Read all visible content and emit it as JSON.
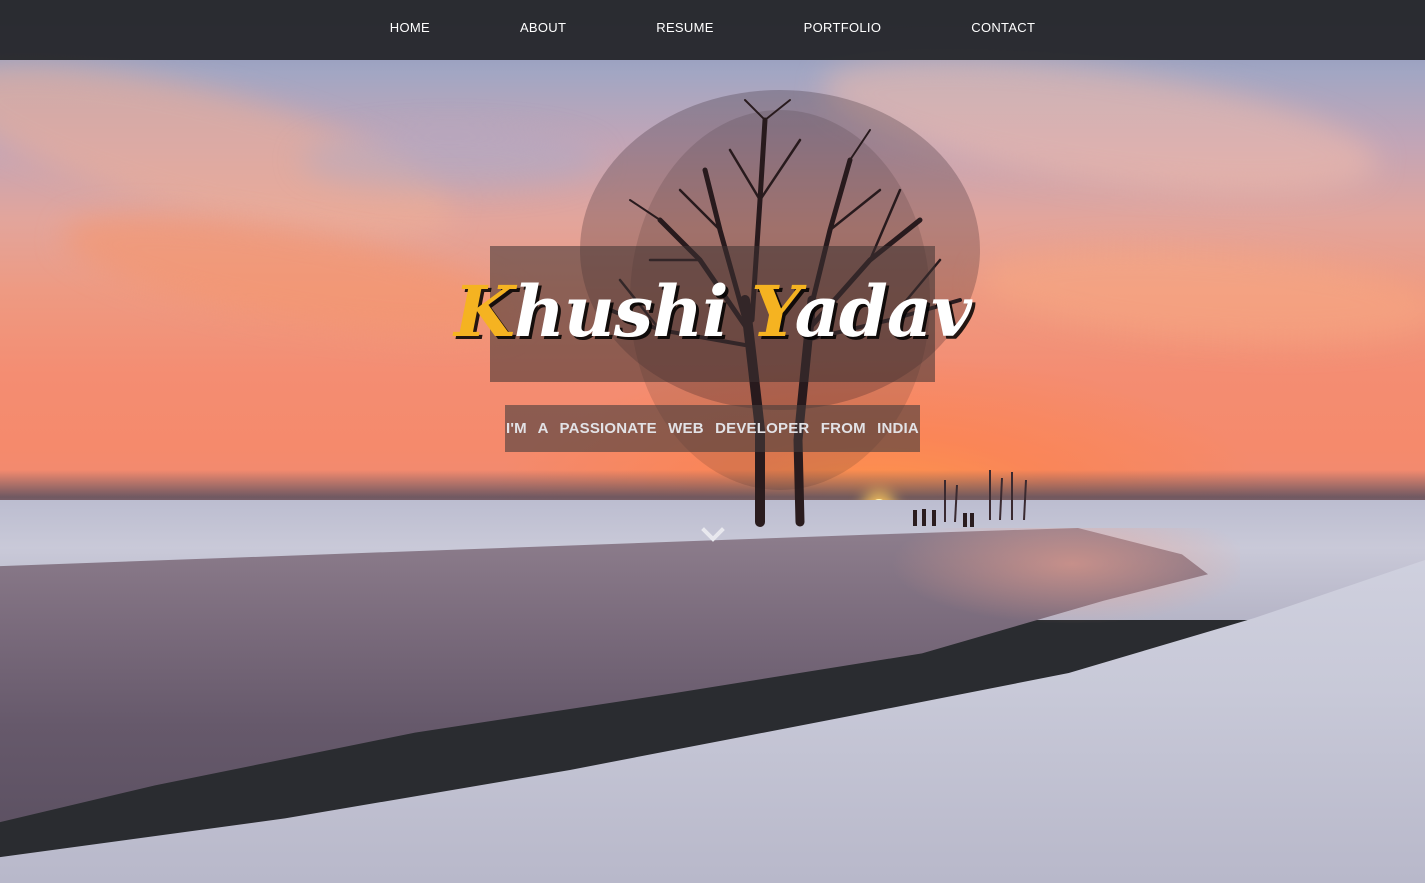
{
  "nav": {
    "items": [
      {
        "label": "HOME"
      },
      {
        "label": "ABOUT"
      },
      {
        "label": "RESUME"
      },
      {
        "label": "PORTFOLIO"
      },
      {
        "label": "CONTACT"
      }
    ]
  },
  "hero": {
    "name_first_initial": "K",
    "name_first_rest": "hushi",
    "name_last_initial": "Y",
    "name_last_rest": "adav",
    "tagline": "I'M A PASSIONATE WEB DEVELOPER FROM INDIA",
    "scroll_icon": "chevron-down-icon"
  },
  "colors": {
    "accent": "#f5b321",
    "navbar_bg": "#26282c",
    "text_light": "#ffffff"
  }
}
